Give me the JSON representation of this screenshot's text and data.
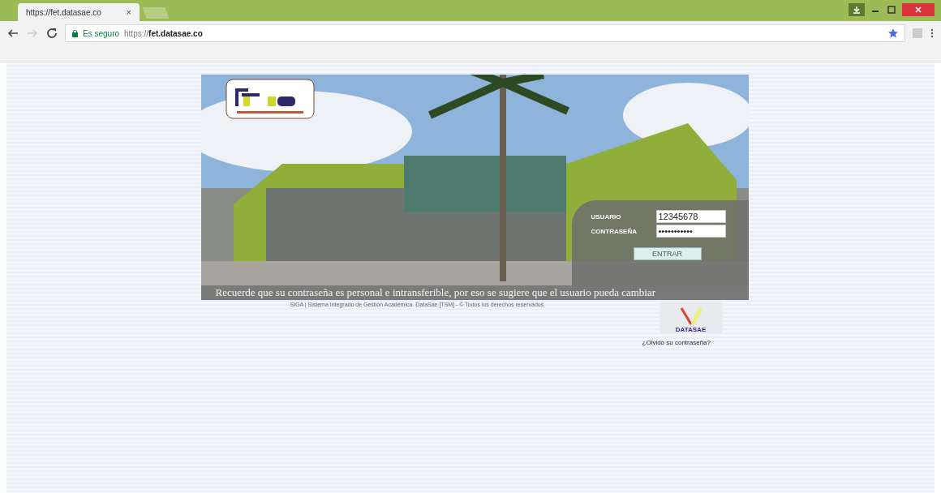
{
  "browser": {
    "tab": {
      "title": "https://fet.datasae.co",
      "close": "×"
    },
    "address": {
      "secure_label": "Es seguro",
      "url_prefix": "https://",
      "url_host": "fet.datasae.co"
    }
  },
  "banner": {
    "marquee": "Recuerde que su contraseña es personal e intransferible, por eso se sugiere que el usuario pueda cambiar"
  },
  "login": {
    "user_label": "USUARIO",
    "user_value": "12345678",
    "password_label": "CONTRASEÑA",
    "password_value": "•••••••••••",
    "submit": "ENTRAR"
  },
  "footer": {
    "copyright": "SIGA | Sistema Integrado de Gestión Académica. DataSae [TSM] - © Todos los derechos reservados",
    "brand": "DATASAE",
    "forgot_link": "¿Olvidó su contraseña?"
  }
}
